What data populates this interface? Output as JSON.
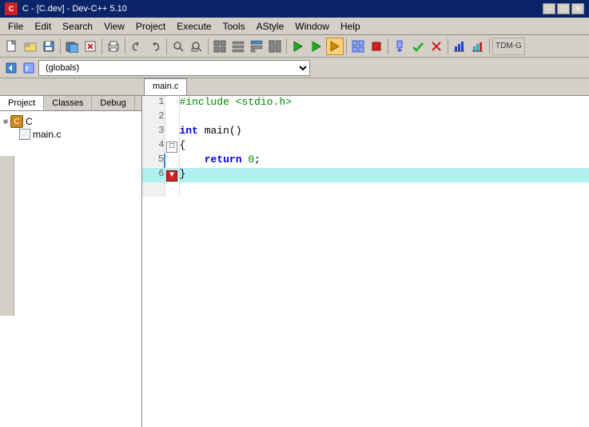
{
  "titlebar": {
    "icon_label": "C",
    "title": "C - [C.dev] - Dev-C++ 5.10",
    "minimize": "─",
    "maximize": "□",
    "close": "✕"
  },
  "menubar": {
    "items": [
      "File",
      "Edit",
      "Search",
      "View",
      "Project",
      "Execute",
      "Tools",
      "AStyle",
      "Window",
      "Help"
    ]
  },
  "toolbar": {
    "scope_dropdown": "(globals)",
    "scope_placeholder": "(globals)"
  },
  "tabs": {
    "active": "main.c"
  },
  "sidebar": {
    "tabs": [
      "Project",
      "Classes",
      "Debug"
    ],
    "active_tab": "Project",
    "tree": {
      "root": "C",
      "children": [
        "main.c"
      ]
    }
  },
  "code": {
    "filename": "main.c",
    "lines": [
      {
        "num": 1,
        "content": "#include <stdio.h>",
        "type": "preprocessor"
      },
      {
        "num": 2,
        "content": "",
        "type": "normal"
      },
      {
        "num": 3,
        "content": "int main()",
        "type": "normal"
      },
      {
        "num": 4,
        "content": "{",
        "type": "brace-open"
      },
      {
        "num": 5,
        "content": "    return 0;",
        "type": "normal"
      },
      {
        "num": 6,
        "content": "}",
        "type": "brace-close-highlight"
      }
    ]
  }
}
